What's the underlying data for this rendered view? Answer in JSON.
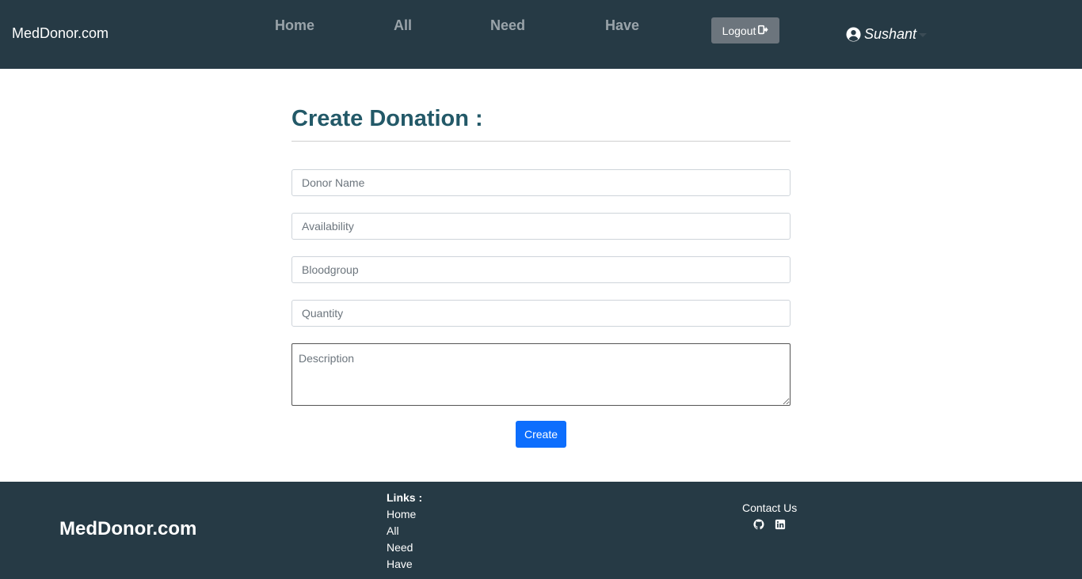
{
  "navbar": {
    "brand": "MedDonor.com",
    "links": [
      "Home",
      "All",
      "Need",
      "Have"
    ],
    "logout_label": "Logout",
    "user_name": "Sushant"
  },
  "form": {
    "title": "Create Donation :",
    "donor_name_placeholder": "Donor Name",
    "availability_placeholder": "Availability",
    "bloodgroup_placeholder": "Bloodgroup",
    "quantity_placeholder": "Quantity",
    "description_placeholder": "Description",
    "submit_label": "Create"
  },
  "footer": {
    "brand": "MedDonor.com",
    "links_title": "Links :",
    "links": [
      "Home",
      "All",
      "Need",
      "Have"
    ],
    "contact_title": "Contact Us"
  },
  "icons": {
    "logout": "sign-out-icon",
    "user": "user-circle-icon",
    "github": "github-icon",
    "linkedin": "linkedin-icon"
  },
  "colors": {
    "navbar_bg": "#263a45",
    "title": "#235968",
    "primary_button": "#0d6efd",
    "logout_button": "#6c757d"
  }
}
